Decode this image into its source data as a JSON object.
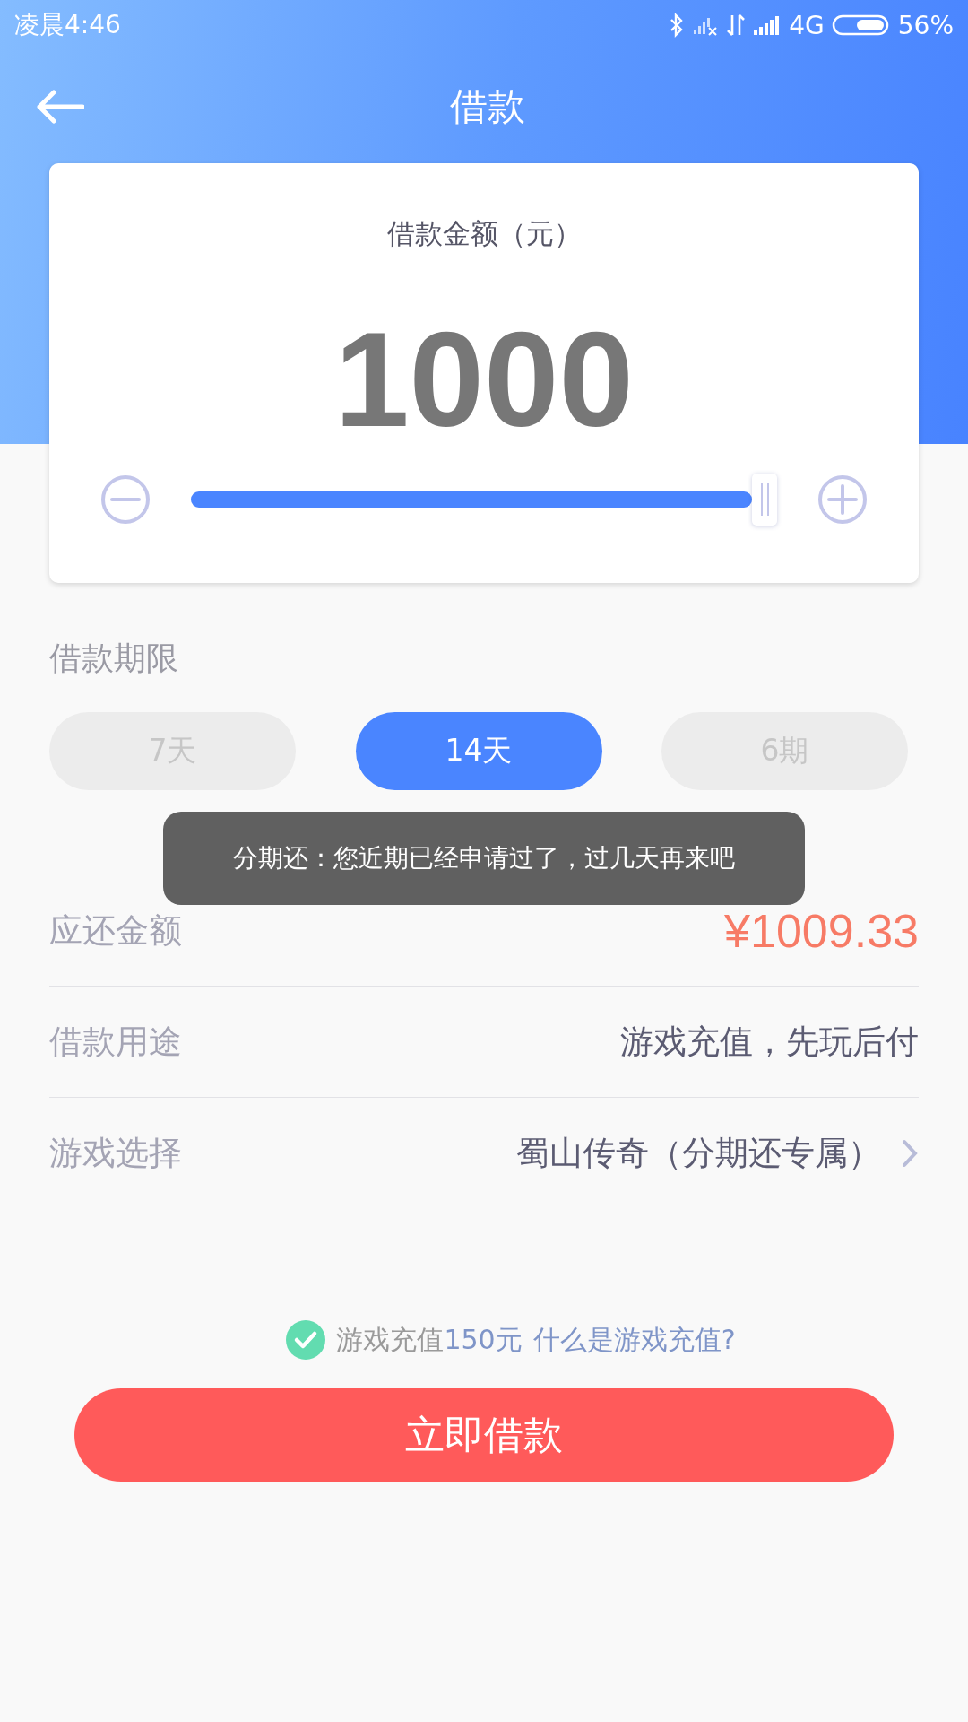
{
  "status_bar": {
    "time": "凌晨4:46",
    "network": "4G",
    "battery": "56%"
  },
  "header": {
    "title": "借款"
  },
  "amount_card": {
    "label": "借款金额（元）",
    "amount": "1000",
    "slider": {
      "level": 1.0
    }
  },
  "term": {
    "label": "借款期限",
    "options": [
      {
        "label": "7天",
        "selected": false
      },
      {
        "label": "14天",
        "selected": true
      },
      {
        "label": "6期",
        "selected": false
      }
    ]
  },
  "rows": [
    {
      "kind": "amount",
      "label": "应还金额",
      "value": "¥1009.33"
    },
    {
      "kind": "text",
      "label": "借款用途",
      "value": "游戏充值，先玩后付"
    },
    {
      "kind": "select",
      "label": "游戏选择",
      "value": "蜀山传奇（分期还专属）"
    }
  ],
  "toast": {
    "text": "分期还：您近期已经申请过了，过几天再来吧"
  },
  "agreement": {
    "checked": true,
    "text": "游戏充值",
    "highlight": "150元",
    "link": "什么是游戏充值?"
  },
  "submit": {
    "label": "立即借款"
  }
}
